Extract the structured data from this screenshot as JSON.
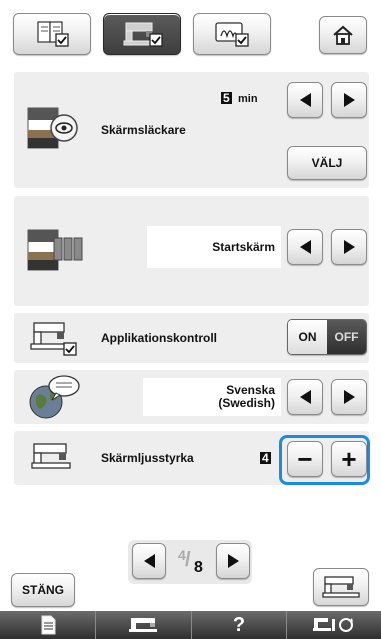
{
  "top_tabs": [
    {
      "name": "settings-page-1",
      "icon": "book-check-icon"
    },
    {
      "name": "settings-page-2",
      "icon": "machine-check-icon"
    },
    {
      "name": "settings-page-3",
      "icon": "embroidery-frame-check-icon"
    }
  ],
  "home": {
    "icon": "home-icon"
  },
  "screensaver": {
    "label": "Skärmsläckare",
    "time_value": "5",
    "time_unit": "min",
    "select_label": "VÄLJ"
  },
  "startup": {
    "label": "",
    "value": "Startskärm"
  },
  "app_control": {
    "label": "Applikationskontroll",
    "on_label": "ON",
    "off_label": "OFF",
    "state": "OFF"
  },
  "language": {
    "value_line1": "Svenska",
    "value_line2": "(Swedish)"
  },
  "brightness": {
    "label": "Skärmljusstyrka",
    "value": "4",
    "minus": "−",
    "plus": "+"
  },
  "pager": {
    "current": "4",
    "total": "8"
  },
  "close_label": "STÄNG",
  "bottom_bar": {
    "help_label": "?"
  },
  "colors": {
    "highlight": "#1a8ce0",
    "panel": "#eeeeee",
    "dark_bar": "#3a3a3a"
  }
}
